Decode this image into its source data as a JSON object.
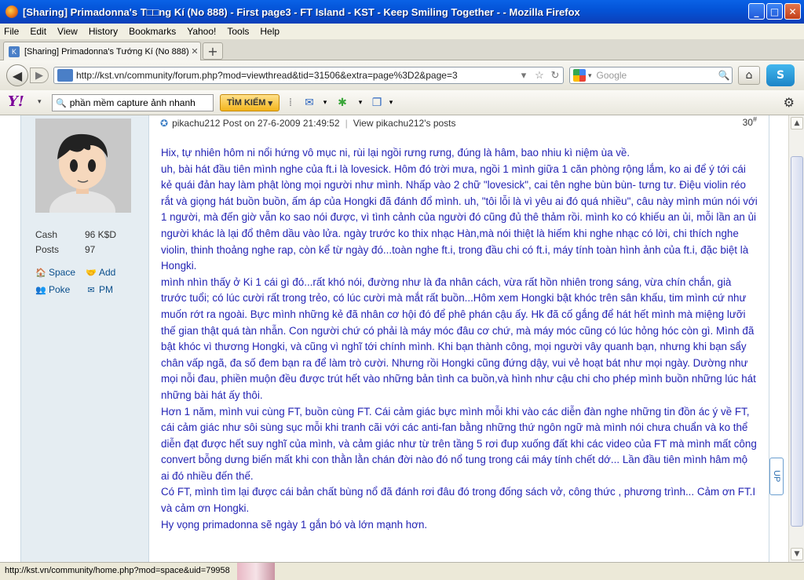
{
  "window": {
    "title": "[Sharing] Primadonna's T□□ng Kí (No 888) - First page3 - FT Island - KST - Keep Smiling Together - - Mozilla Firefox"
  },
  "menu": [
    "File",
    "Edit",
    "View",
    "History",
    "Bookmarks",
    "Yahoo!",
    "Tools",
    "Help"
  ],
  "tab": {
    "label": "[Sharing] Primadonna's Tướng Kí (No 888) - ...",
    "new_tab": "+"
  },
  "nav": {
    "url": "http://kst.vn/community/forum.php?mod=viewthread&tid=31506&extra=page%3D2&page=3",
    "search_placeholder": "Google"
  },
  "yahoo": {
    "search_value": "phần mềm capture ảnh nhanh",
    "search_button": "TÌM KIẾM"
  },
  "profile": {
    "stats": [
      {
        "label": "Cash",
        "value": "96 K$D"
      },
      {
        "label": "Posts",
        "value": "97"
      }
    ],
    "links": [
      {
        "label": "Space",
        "icon": "house-icon"
      },
      {
        "label": "Add",
        "icon": "handshake-icon"
      },
      {
        "label": "Poke",
        "icon": "people-icon"
      },
      {
        "label": "PM",
        "icon": "mail-icon"
      }
    ]
  },
  "post": {
    "author": "pikachu212",
    "posted": "Post on 27-6-2009 21:49:52",
    "view_posts": "View pikachu212's posts",
    "floor": "30",
    "floor_sup": "#",
    "paragraphs": [
      "Hix, tự nhiên hôm ni nổi hứng vô mục ni, rùi lại ngồi rưng rưng, đúng là hâm, bao nhiu kì niệm ùa về.",
      "uh, bài hát đầu tiên mình nghe của ft.i là lovesick. Hôm đó trời mưa, ngồi 1 mình giữa 1 căn phòng rộng lắm, ko ai để ý tới cái kẻ quái đản hay làm phật lòng mọi người như mình. Nhấp vào 2 chữ \"lovesick\", cai tên nghe bùn bùn- tưng tư. Điệu violin réo rắt và giọng hát buồn buồn, ấm áp của Hongki đã đánh đổ mình. uh, \"tôi lỗi là vì yêu ai đó quá nhiều\", câu này mình mún nói với 1 người, mà đến giờ vẫn ko sao nói được, vì tình cảnh của người đó cũng đủ thê thảm rồi. mình ko có khiếu an ủi, mỗi lần an ủi người khác là lại đổ thêm dầu vào lửa. ngày trước ko thix nhạc Hàn,mà nói thiệt là hiếm khi nghe nhạc có lời, chi thích nghe violin, thinh thoảng nghe rap, còn kể từ ngày đó...toàn nghe ft.i, trong đầu chi có ft.i, máy tính toàn hình ảnh của ft.i, đặc biệt là Hongki.",
      "mình nhìn thấy ở Ki 1 cái gì đó...rất khó nói, đường như là đa nhân cách, vừa rất hồn nhiên trong sáng, vừa chín chắn, già trước tuổi; có lúc cười rất trong trẻo, có lúc cười mà mắt rất buồn...Hôm xem Hongki bật khóc trên sân khấu, tim mình cứ như muốn rớt ra ngoài. Bực mình những kẻ đã nhân cơ hội đó để phê phán cậu ấy. Hk đã cố gắng để hát hết mình mà miệng lưỡi thế gian thật quá tàn nhẫn. Con người chứ có phải là máy móc đâu cơ chứ, mà máy móc cũng có lúc hỏng hóc còn gì. Mình đã bật khóc vì thương Hongki, và cũng vì nghĩ tới chính mình. Khi bạn thành công, mọi người vây quanh bạn, nhưng khi bạn sẩy chân vấp ngã, đa số đem bạn ra để làm trò cười. Nhưng rồi Hongki cũng đứng dậy, vui vẻ hoạt bát như mọi ngày. Dường như mọi nỗi đau, phiền muộn đều được trút hết vào những bản tình ca buồn,và hình như cậu chi cho phép mình buồn những lúc hát những bài hát ấy thôi.",
      "Hơn 1 năm, mình vui cùng FT, buồn cùng FT. Cái cảm giác bực mình mỗi khi vào các diễn đàn nghe những tin đồn ác ý về FT, cái cảm giác như sôi sùng sục mỗi khi tranh cãi với các anti-fan bằng những thứ ngôn ngữ mà mình nói chưa chuẩn và ko thể diễn đạt được hết suy  nghĩ của mình, và cảm giác như từ trên tầng 5 rơi đup xuống đất khi các video của FT mà mình mất công convert bỗng dưng biến mất khi con thằn lằn chán đời nào đó nổ tung trong cái máy tính chết dớ... Lần đầu tiên mình hâm mộ ai đó nhiều đến thế.",
      "Có FT, mình tìm lại được cái bản chất bùng nổ đã đánh rơi đâu đó trong đống sách vở, công thức , phương trình... Cảm ơn FT.I và cảm ơn Hongki.",
      "Hy vọng primadonna sẽ ngày 1 gắn bó và lớn mạnh hơn."
    ]
  },
  "scroll": {
    "badge": "UP"
  },
  "status": {
    "text": "http://kst.vn/community/home.php?mod=space&uid=79958"
  }
}
